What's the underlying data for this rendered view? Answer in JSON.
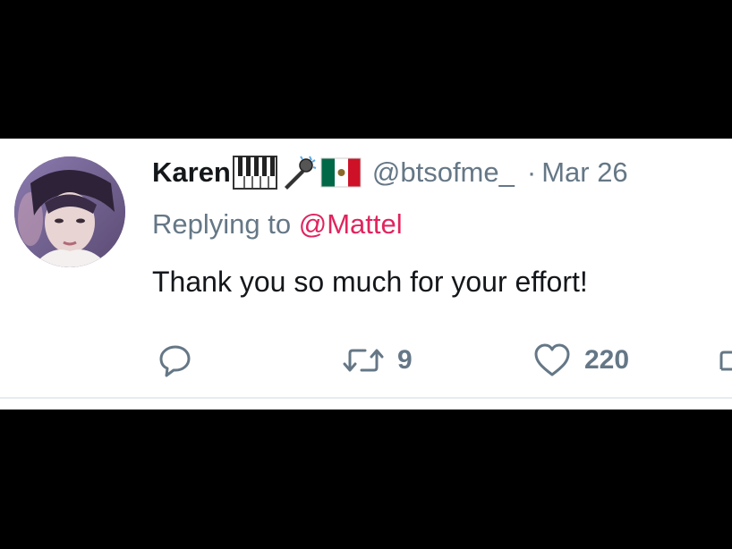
{
  "tweet": {
    "display_name": "Karen",
    "handle": "@btsofme_",
    "separator": "·",
    "date": "Mar 26",
    "reply_prefix": "Replying to",
    "reply_mention": "@Mattel",
    "text": "Thank you so much for your effort!",
    "name_emojis": [
      "piano-keys-emoji",
      "microphone-emoji",
      "mexico-flag-emoji"
    ]
  },
  "actions": {
    "reply_count": "",
    "retweet_count": "9",
    "like_count": "220"
  },
  "colors": {
    "text_primary": "#14171a",
    "text_secondary": "#657786",
    "mention": "#e0245e",
    "background": "#ffffff",
    "letterbox": "#000000"
  }
}
